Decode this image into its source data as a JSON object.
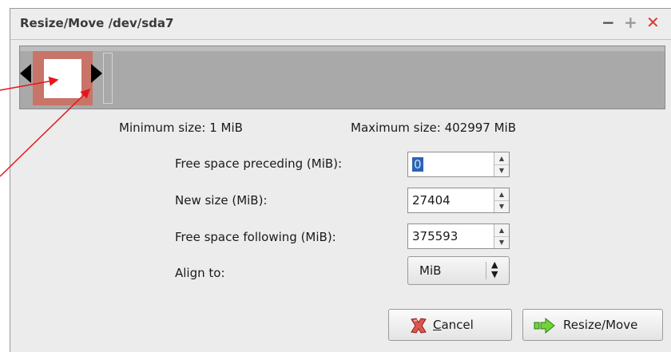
{
  "window": {
    "title": "Resize/Move /dev/sda7",
    "controls": {
      "minimize": "−",
      "maximize": "+",
      "close": "✕"
    }
  },
  "sizes": {
    "minimum": "Minimum size: 1 MiB",
    "maximum": "Maximum size: 402997 MiB"
  },
  "fields": {
    "preceding_label": "Free space preceding (MiB):",
    "preceding_value": "0",
    "new_size_label": "New size (MiB):",
    "new_size_value": "27404",
    "following_label": "Free space following (MiB):",
    "following_value": "375593",
    "align_label": "Align to:",
    "align_value": "MiB"
  },
  "buttons": {
    "cancel_label": "Cancel",
    "apply_label": "Resize/Move"
  },
  "colors": {
    "partition": "#c87468",
    "unallocated": "#a9a9a9",
    "annotation_arrow": "#e8141c"
  }
}
